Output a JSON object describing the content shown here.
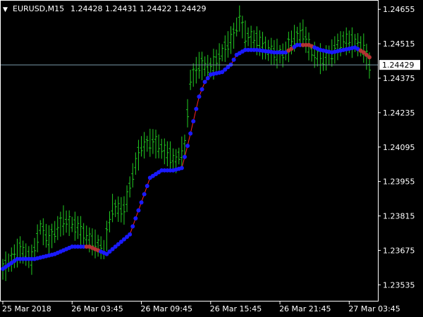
{
  "header": {
    "symbol": "EURUSD,M15",
    "ohlc": "1.24428 1.24431 1.24422 1.24429"
  },
  "colors": {
    "background": "#000000",
    "frame": "#ffffff",
    "bars": "#22cc22",
    "ma_line": "#ff2222",
    "dot_up": "#1a1aff",
    "dot_down": "#b33333",
    "ask_line": "#7a9aaa"
  },
  "chart_data": {
    "type": "line",
    "title": "EURUSD,M15",
    "current_price": 1.24429,
    "current_price_label": "1.24429",
    "ylim": [
      1.2347,
      1.2469
    ],
    "y_ticks": [
      1.24655,
      1.24515,
      1.24375,
      1.24235,
      1.24095,
      1.23955,
      1.23815,
      1.23675,
      1.23535
    ],
    "y_tick_labels": [
      "1.24655",
      "1.24515",
      "1.24375",
      "1.24235",
      "1.24095",
      "1.23955",
      "1.23815",
      "1.23675",
      "1.23535"
    ],
    "x_tick_labels": [
      "25 Mar 2018",
      "26 Mar 03:45",
      "26 Mar 09:45",
      "26 Mar 15:45",
      "26 Mar 21:45",
      "27 Mar 03:45"
    ],
    "x_tick_bars": [
      0,
      24,
      48,
      72,
      96,
      120
    ],
    "bar_count": 128,
    "ma_anchors": [
      [
        0,
        1.236
      ],
      [
        5,
        1.2364
      ],
      [
        11,
        1.2364
      ],
      [
        18,
        1.2366
      ],
      [
        24,
        1.2369
      ],
      [
        30,
        1.2369
      ],
      [
        36,
        1.2366
      ],
      [
        40,
        1.237
      ],
      [
        44,
        1.2374
      ],
      [
        48,
        1.2387
      ],
      [
        51,
        1.2397
      ],
      [
        55,
        1.24
      ],
      [
        59,
        1.24
      ],
      [
        62,
        1.2401
      ],
      [
        64,
        1.241
      ],
      [
        66,
        1.242
      ],
      [
        68,
        1.243
      ],
      [
        70,
        1.2436
      ],
      [
        72,
        1.2439
      ],
      [
        76,
        1.244
      ],
      [
        79,
        1.2443
      ],
      [
        81,
        1.2447
      ],
      [
        84,
        1.2449
      ],
      [
        88,
        1.2449
      ],
      [
        94,
        1.2448
      ],
      [
        98,
        1.2448
      ],
      [
        102,
        1.2451
      ],
      [
        106,
        1.2451
      ],
      [
        110,
        1.2449
      ],
      [
        114,
        1.2448
      ],
      [
        118,
        1.2449
      ],
      [
        122,
        1.245
      ],
      [
        125,
        1.2448
      ],
      [
        127,
        1.2446
      ]
    ],
    "bar_anchors": [
      [
        0,
        1.236
      ],
      [
        6,
        1.2368
      ],
      [
        10,
        1.2364
      ],
      [
        13,
        1.2377
      ],
      [
        16,
        1.2372
      ],
      [
        21,
        1.238
      ],
      [
        26,
        1.2377
      ],
      [
        30,
        1.2372
      ],
      [
        35,
        1.2368
      ],
      [
        38,
        1.2385
      ],
      [
        42,
        1.2384
      ],
      [
        46,
        1.2403
      ],
      [
        48,
        1.241
      ],
      [
        52,
        1.2412
      ],
      [
        56,
        1.2408
      ],
      [
        60,
        1.2404
      ],
      [
        63,
        1.241
      ],
      [
        65,
        1.2437
      ],
      [
        68,
        1.2443
      ],
      [
        72,
        1.2442
      ],
      [
        76,
        1.2448
      ],
      [
        80,
        1.2455
      ],
      [
        82,
        1.2462
      ],
      [
        84,
        1.2455
      ],
      [
        88,
        1.2453
      ],
      [
        92,
        1.2449
      ],
      [
        97,
        1.2447
      ],
      [
        101,
        1.2454
      ],
      [
        104,
        1.2456
      ],
      [
        107,
        1.2448
      ],
      [
        111,
        1.2445
      ],
      [
        114,
        1.2448
      ],
      [
        118,
        1.2453
      ],
      [
        122,
        1.2452
      ],
      [
        125,
        1.245
      ],
      [
        127,
        1.24429
      ]
    ],
    "down_segments": [
      [
        29,
        33
      ],
      [
        99,
        100
      ],
      [
        104,
        107
      ],
      [
        124,
        127
      ]
    ]
  }
}
